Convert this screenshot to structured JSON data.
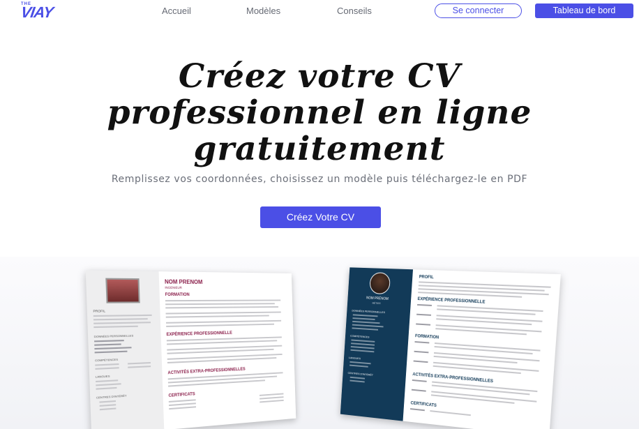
{
  "nav": {
    "logo_small": "THE",
    "logo_word": "VIAY",
    "links": [
      "Accueil",
      "Modèles",
      "Conseils"
    ],
    "login": "Se connecter",
    "dashboard": "Tableau de bord"
  },
  "hero": {
    "title_line1": "Créez votre CV",
    "title_line2": "professionnel en ligne",
    "title_line3": "gratuitement",
    "subtitle": "Remplissez vos coordonnées, choisissez un modèle puis téléchargez-le en PDF",
    "cta": "Créez Votre CV"
  },
  "cv1": {
    "name": "NOM PRENOM",
    "job": "INGENIEUR",
    "section_formation": "FORMATION",
    "section_experience": "EXPÉRIENCE PROFESSIONNELLE",
    "section_activites": "ACTIVITÉS EXTRA-PROFESSIONNELLES",
    "section_certificats": "CERTIFICATS",
    "side_profil": "PROFIL",
    "side_donnees": "DONNÉES PERSONNELLES",
    "side_competences": "COMPÉTENCES",
    "side_langues": "LANGUES",
    "side_interet": "CENTRES D'INTÉRÊT",
    "accent": "#8a1e4a"
  },
  "cv2": {
    "name": "NOM PRÉNOM",
    "job": "MÉTIER",
    "section_profil": "PROFIL",
    "section_experience": "EXPÉRIENCE PROFESSIONNELLE",
    "section_formation": "FORMATION",
    "section_activites": "ACTIVITÉS EXTRA-PROFESSIONNELLES",
    "section_certificats": "CERTIFICATS",
    "side_donnees": "DONNÉES PERSONNELLES",
    "side_competences": "COMPÉTENCES",
    "side_langues": "LANGUES",
    "side_interet": "CENTRES D'INTÉRÊT",
    "accent": "#123a58"
  }
}
